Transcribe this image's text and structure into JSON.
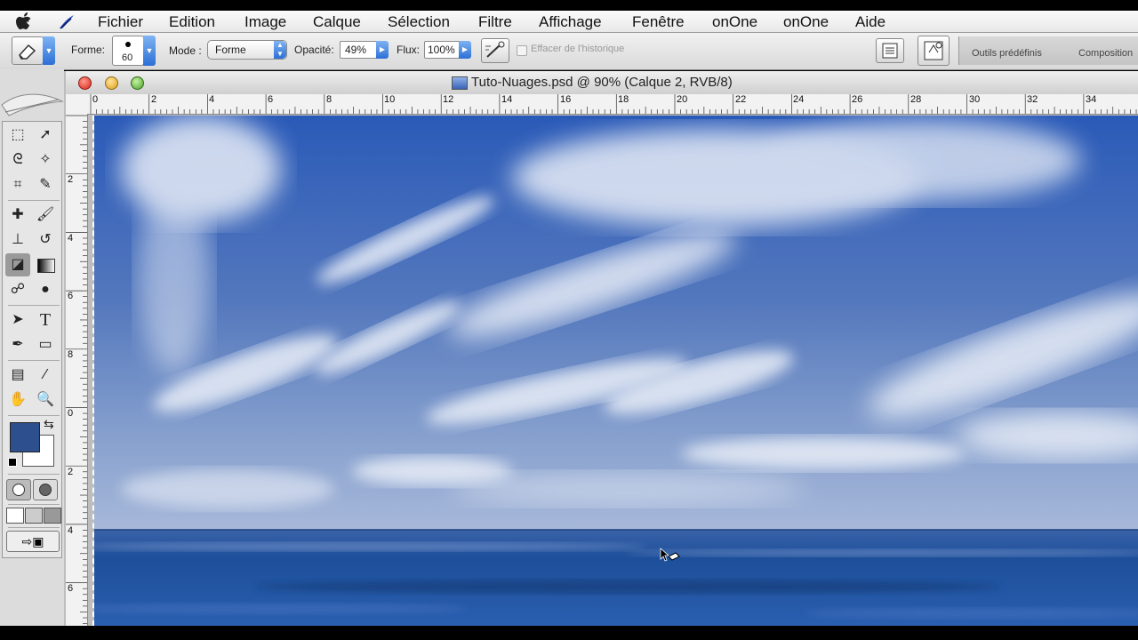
{
  "menubar": {
    "items": [
      "Fichier",
      "Edition",
      "Image",
      "Calque",
      "Sélection",
      "Filtre",
      "Affichage",
      "Fenêtre",
      "onOne",
      "onOne",
      "Aide"
    ]
  },
  "options": {
    "forme_label": "Forme:",
    "brush_size": "60",
    "mode_label": "Mode :",
    "mode_value": "Forme",
    "opacity_label": "Opacité:",
    "opacity_value": "49%",
    "flux_label": "Flux:",
    "flux_value": "100%",
    "history_label": "Effacer de l'historique",
    "well_tabs": [
      "Outils prédéfinis",
      "Composition"
    ]
  },
  "document": {
    "title": "Tuto-Nuages.psd @ 90% (Calque 2, RVB/8)",
    "hruler_ticks": [
      "0",
      "2",
      "4",
      "6",
      "8",
      "10",
      "12",
      "14",
      "16",
      "18",
      "20",
      "22",
      "24",
      "26",
      "28",
      "30",
      "32",
      "34"
    ],
    "vruler_ticks": [
      "2",
      "4",
      "6",
      "8",
      "0",
      "2",
      "4",
      "6"
    ]
  },
  "colors": {
    "foreground": "#2e4f8e",
    "background": "#ffffff",
    "sky_top": "#2a5ab8",
    "sea": "#1d4f9a"
  },
  "icons": {
    "tools": [
      "marquee-icon",
      "move-icon",
      "lasso-icon",
      "magic-wand-icon",
      "crop-icon",
      "slice-icon",
      "healing-brush-icon",
      "brush-icon",
      "stamp-icon",
      "history-brush-icon",
      "eraser-icon",
      "gradient-icon",
      "blur-icon",
      "dodge-icon",
      "path-select-icon",
      "type-icon",
      "pen-icon",
      "shape-icon",
      "notes-icon",
      "eyedropper-icon",
      "hand-icon",
      "zoom-icon"
    ]
  }
}
